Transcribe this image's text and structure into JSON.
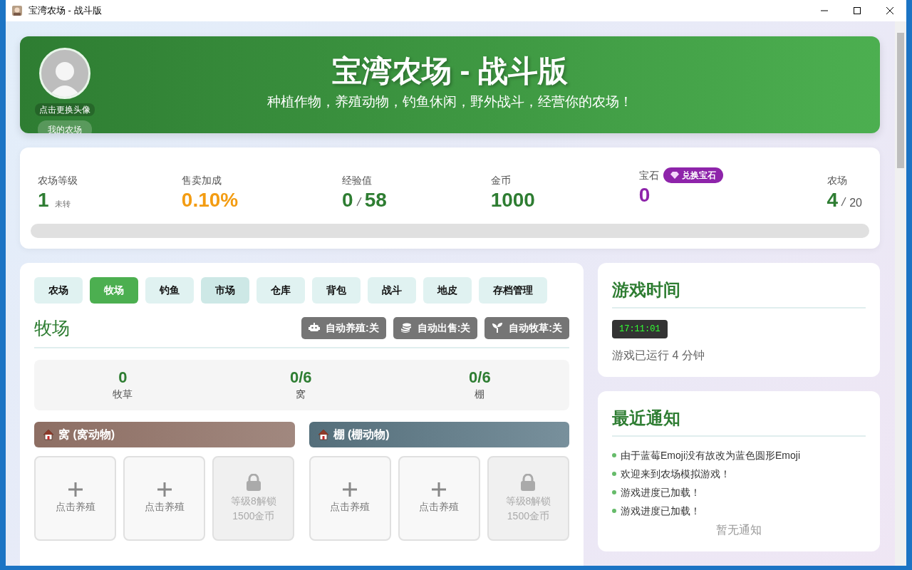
{
  "window": {
    "title": "宝湾农场 - 战斗版"
  },
  "header": {
    "avatar_caption": "点击更换头像",
    "farm_button": "我的农场",
    "title": "宝湾农场 - 战斗版",
    "subtitle": "种植作物，养殖动物，钓鱼休闲，野外战斗，经营你的农场！"
  },
  "stats": [
    {
      "kind": "level",
      "label": "农场等级",
      "value": "1",
      "note": "未转"
    },
    {
      "kind": "bonus",
      "label": "售卖加成",
      "value": "0.10%"
    },
    {
      "kind": "ratio",
      "label": "经验值",
      "value": "0",
      "total": "58"
    },
    {
      "kind": "plain",
      "label": "金币",
      "value": "1000"
    },
    {
      "kind": "gem",
      "label": "宝石",
      "button": "兑换宝石",
      "value": "0"
    },
    {
      "kind": "farms",
      "label": "农场",
      "value": "4",
      "total": "20"
    }
  ],
  "exp_bar": {
    "level": 0
  },
  "tabs": [
    {
      "label": "农场",
      "selected": false
    },
    {
      "label": "牧场",
      "selected": true
    },
    {
      "label": "钓鱼",
      "selected": false
    },
    {
      "label": "市场",
      "selected": false,
      "hover": true
    },
    {
      "label": "仓库",
      "selected": false
    },
    {
      "label": "背包",
      "selected": false
    },
    {
      "label": "战斗",
      "selected": false
    },
    {
      "label": "地皮",
      "selected": false
    },
    {
      "label": "存档管理",
      "selected": false
    }
  ],
  "section": {
    "title": "牧场",
    "toggles": [
      {
        "kind": "robot",
        "label": "自动养殖:关",
        "on": false
      },
      {
        "kind": "coins",
        "label": "自动出售:关",
        "on": false
      },
      {
        "kind": "sprout",
        "label": "自动牧草:关",
        "on": false
      }
    ],
    "summary": [
      {
        "value": "0",
        "label": "牧草"
      },
      {
        "value": "0/6",
        "label": "窝"
      },
      {
        "value": "0/6",
        "label": "棚"
      }
    ],
    "pens": [
      {
        "kind": "nest",
        "title": "窝 (窝动物)",
        "slots": [
          {
            "kind": "empty",
            "text": "点击养殖"
          },
          {
            "kind": "empty",
            "text": "点击养殖"
          },
          {
            "kind": "locked",
            "text": "等级8解锁",
            "cost": "1500金币"
          }
        ]
      },
      {
        "kind": "shed",
        "title": "棚 (棚动物)",
        "slots": [
          {
            "kind": "empty",
            "text": "点击养殖"
          },
          {
            "kind": "empty",
            "text": "点击养殖"
          },
          {
            "kind": "locked",
            "text": "等级8解锁",
            "cost": "1500金币"
          }
        ]
      }
    ]
  },
  "time_card": {
    "title": "游戏时间",
    "clock": "17:11:01",
    "runtime": "游戏已运行 4 分钟"
  },
  "notices": {
    "title": "最近通知",
    "items": [
      "由于蓝莓Emoji没有故改为蓝色圆形Emoji",
      "欢迎来到农场模拟游戏！",
      "游戏进度已加载！",
      "游戏进度已加载！"
    ],
    "empty_text": "暂无通知"
  }
}
